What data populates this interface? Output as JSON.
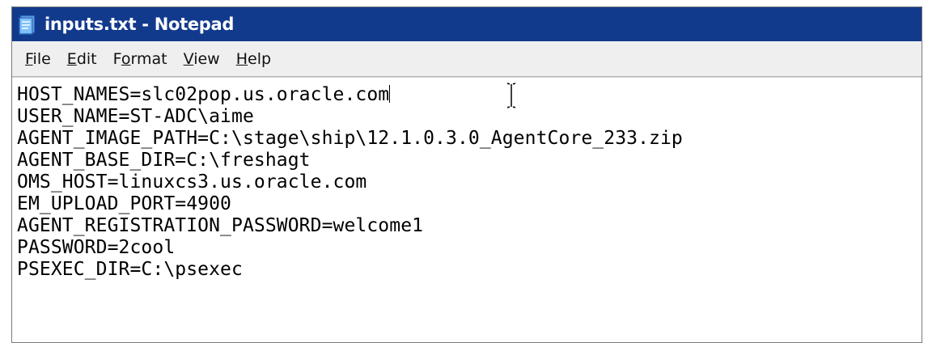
{
  "window": {
    "title": "inputs.txt - Notepad"
  },
  "menu": {
    "items": [
      {
        "key": "F",
        "rest": "ile"
      },
      {
        "key": "E",
        "rest": "dit"
      },
      {
        "key": "F",
        "rest": "ormat",
        "prefix": "",
        "label_full": "Format",
        "mnemonic_index": 1
      },
      {
        "key": "V",
        "rest": "iew"
      },
      {
        "key": "H",
        "rest": "elp"
      }
    ]
  },
  "editor": {
    "lines": [
      "HOST_NAMES=slc02pop.us.oracle.com",
      "USER_NAME=ST-ADC\\aime",
      "AGENT_IMAGE_PATH=C:\\stage\\ship\\12.1.0.3.0_AgentCore_233.zip",
      "AGENT_BASE_DIR=C:\\freshagt",
      "OMS_HOST=linuxcs3.us.oracle.com",
      "EM_UPLOAD_PORT=4900",
      "AGENT_REGISTRATION_PASSWORD=welcome1",
      "PASSWORD=2cool",
      "PSEXEC_DIR=C:\\psexec"
    ]
  },
  "colors": {
    "titlebar": "#123a8c",
    "menubar": "#efefef",
    "editor_bg": "#ffffff",
    "text": "#000000"
  },
  "icons": {
    "app": "notepad-icon",
    "pointer": "i-beam-cursor-icon"
  }
}
